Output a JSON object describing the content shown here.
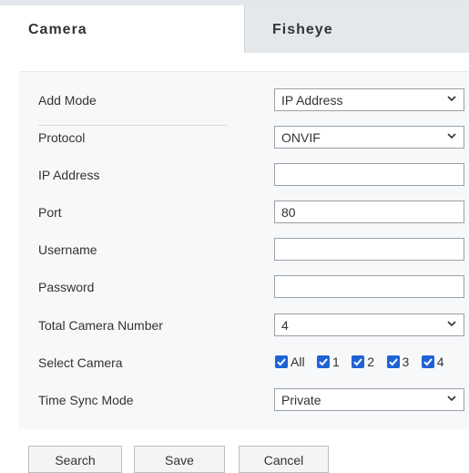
{
  "tabs": [
    {
      "label": "Camera",
      "active": true
    },
    {
      "label": "Fisheye",
      "active": false
    }
  ],
  "form": {
    "add_mode": {
      "label": "Add Mode",
      "value": "IP Address"
    },
    "protocol": {
      "label": "Protocol",
      "value": "ONVIF"
    },
    "ip_address": {
      "label": "IP Address",
      "value": ""
    },
    "port": {
      "label": "Port",
      "value": "80"
    },
    "username": {
      "label": "Username",
      "value": ""
    },
    "password": {
      "label": "Password",
      "value": ""
    },
    "total_camera_number": {
      "label": "Total Camera Number",
      "value": "4"
    },
    "select_camera": {
      "label": "Select Camera",
      "options": [
        {
          "label": "All",
          "checked": true
        },
        {
          "label": "1",
          "checked": true
        },
        {
          "label": "2",
          "checked": true
        },
        {
          "label": "3",
          "checked": true
        },
        {
          "label": "4",
          "checked": true
        }
      ]
    },
    "time_sync_mode": {
      "label": "Time Sync Mode",
      "value": "Private"
    }
  },
  "buttons": {
    "search": "Search",
    "save": "Save",
    "cancel": "Cancel"
  },
  "colors": {
    "checkbox": "#1f63d6",
    "panel_bg": "#f7f8f9",
    "tabbar_bg": "#e9ecef"
  },
  "icons": {
    "select": "chevron-down-icon",
    "checkbox": "checkmark-icon"
  }
}
